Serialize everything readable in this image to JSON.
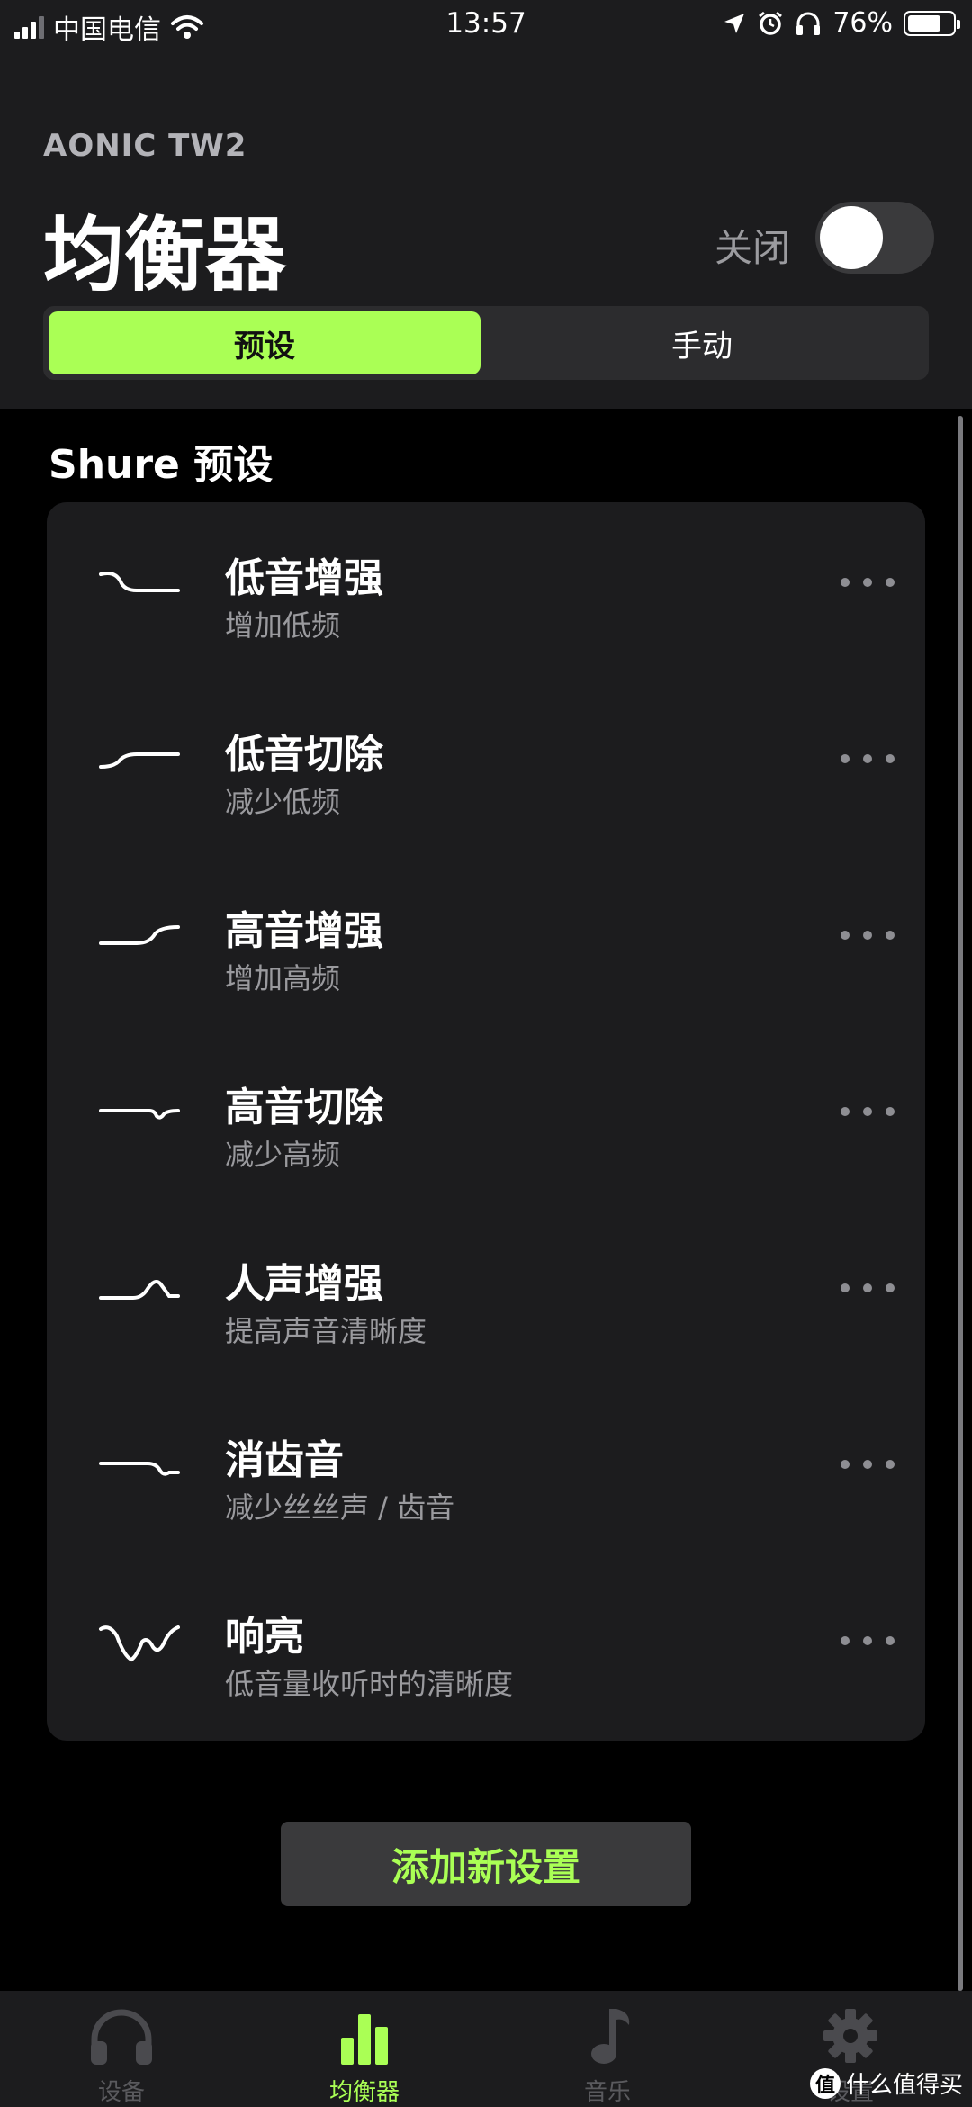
{
  "status_bar": {
    "carrier": "中国电信",
    "time": "13:57",
    "battery": "76%",
    "battery_level": 0.76
  },
  "header": {
    "device_name": "AONIC TW2",
    "title": "均衡器",
    "toggle_label": "关闭",
    "toggle_on": false
  },
  "segments": [
    {
      "label": "预设",
      "active": true
    },
    {
      "label": "手动",
      "active": false
    }
  ],
  "section_title": "Shure 预设",
  "presets": [
    {
      "title": "低音增强",
      "subtitle": "增加低频",
      "icon": "bass-boost-curve-icon"
    },
    {
      "title": "低音切除",
      "subtitle": "减少低频",
      "icon": "bass-cut-curve-icon"
    },
    {
      "title": "高音增强",
      "subtitle": "增加高频",
      "icon": "treble-boost-curve-icon"
    },
    {
      "title": "高音切除",
      "subtitle": "减少高频",
      "icon": "treble-cut-curve-icon"
    },
    {
      "title": "人声增强",
      "subtitle": "提高声音清晰度",
      "icon": "vocal-boost-curve-icon"
    },
    {
      "title": "消齿音",
      "subtitle": "减少丝丝声 / 齿音",
      "icon": "de-ess-curve-icon"
    },
    {
      "title": "响亮",
      "subtitle": "低音量收听时的清晰度",
      "icon": "loudness-curve-icon"
    }
  ],
  "add_button": "添加新设置",
  "tabs": [
    {
      "label": "设备",
      "icon": "headphones-icon",
      "active": false
    },
    {
      "label": "均衡器",
      "icon": "equalizer-bars-icon",
      "active": true
    },
    {
      "label": "音乐",
      "icon": "music-note-icon",
      "active": false
    },
    {
      "label": "设置",
      "icon": "gear-icon",
      "active": false
    }
  ],
  "watermark": {
    "badge": "值",
    "text": "什么值得买"
  },
  "colors": {
    "accent": "#aaff55",
    "background": "#000000",
    "surface": "#1c1c1e"
  }
}
